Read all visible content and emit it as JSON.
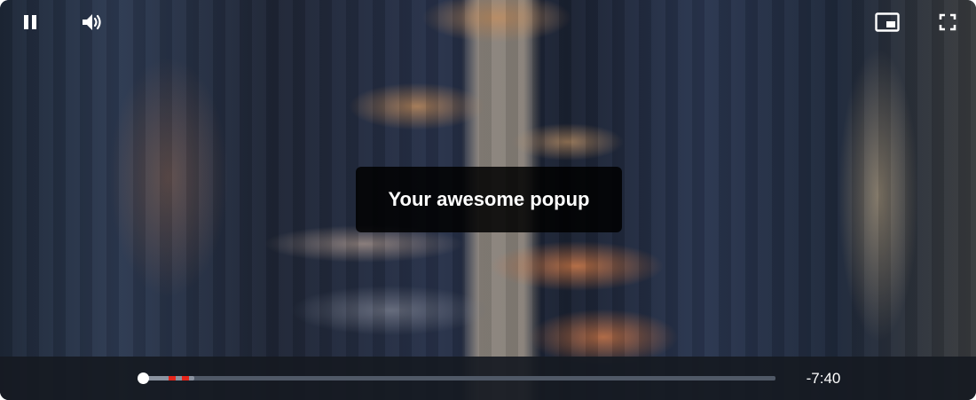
{
  "popup": {
    "text": "Your awesome popup"
  },
  "player": {
    "time_remaining": "-7:40",
    "progress_fraction": 0.0,
    "buffered_fraction": 0.08,
    "markers": [
      0.04,
      0.06
    ],
    "colors": {
      "marker": "#e5261c",
      "track": "#505967",
      "buffered": "#8b93a0"
    },
    "icons": {
      "play_pause": "pause-icon",
      "volume": "volume-icon",
      "pip": "picture-in-picture-icon",
      "fullscreen": "fullscreen-icon"
    }
  }
}
